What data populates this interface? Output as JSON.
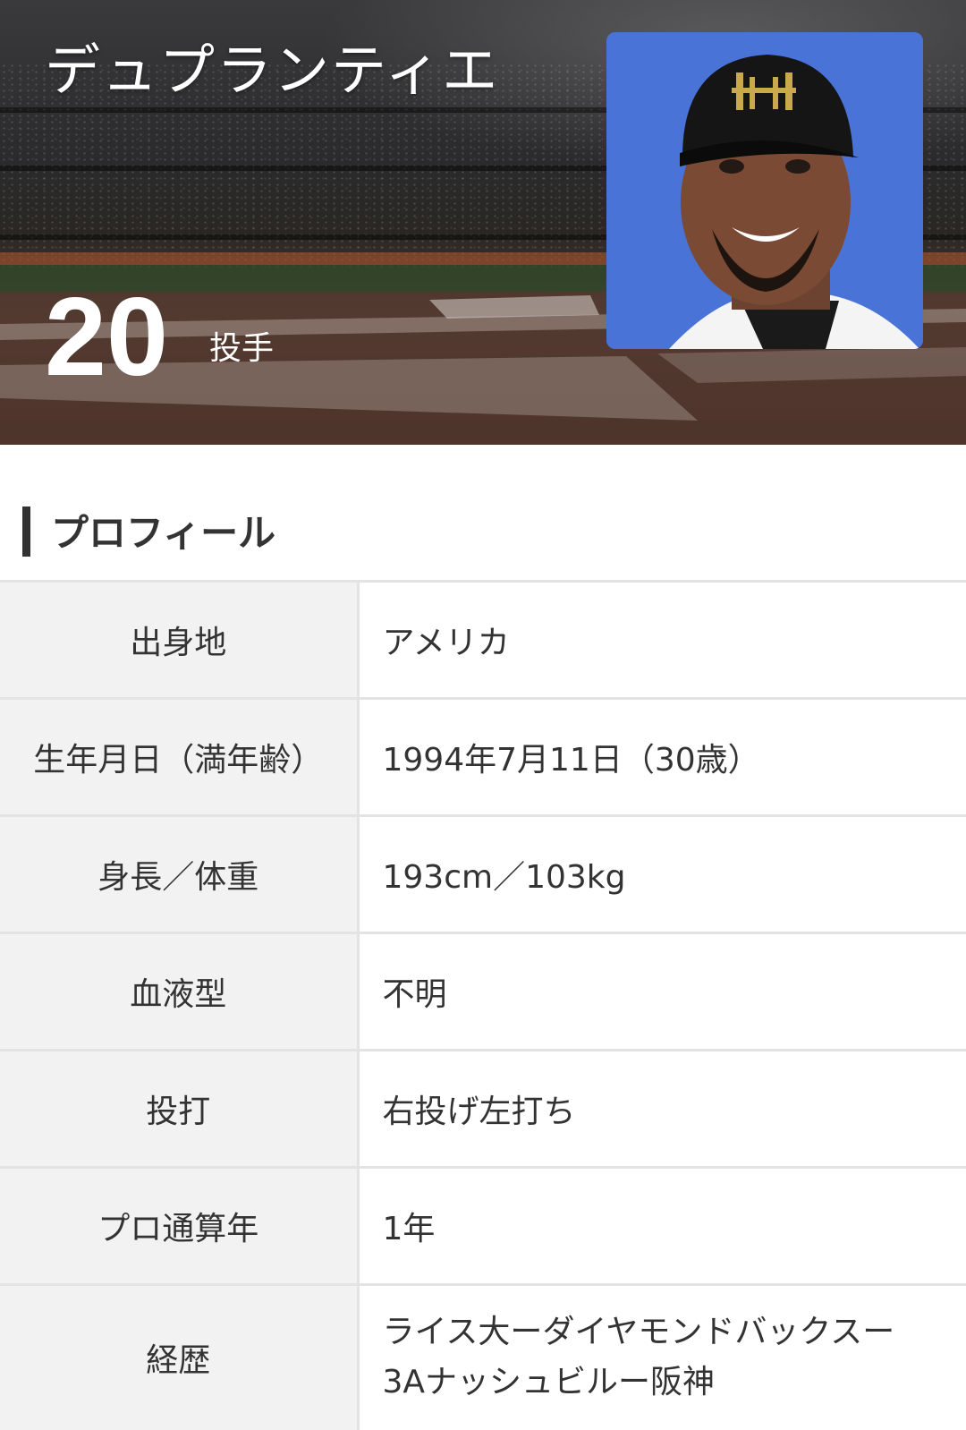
{
  "hero": {
    "name": "デュプランティエ",
    "number": "20",
    "position": "投手"
  },
  "profile": {
    "heading": "プロフィール",
    "rows": [
      {
        "label": "出身地",
        "value": "アメリカ"
      },
      {
        "label": "生年月日（満年齢）",
        "value": "1994年7月11日（30歳）"
      },
      {
        "label": "身長／体重",
        "value": "193cm／103kg"
      },
      {
        "label": "血液型",
        "value": "不明"
      },
      {
        "label": "投打",
        "value": "右投げ左打ち"
      },
      {
        "label": "プロ通算年",
        "value": "1年"
      },
      {
        "label": "経歴",
        "value_line1": "ライス大ーダイヤモンドバックスー",
        "value_line2": "3Aナッシュビルー阪神"
      }
    ]
  },
  "colors": {
    "photo_background": "#4a73d8",
    "label_background": "#f2f2f2",
    "divider": "#e3e3e3"
  }
}
